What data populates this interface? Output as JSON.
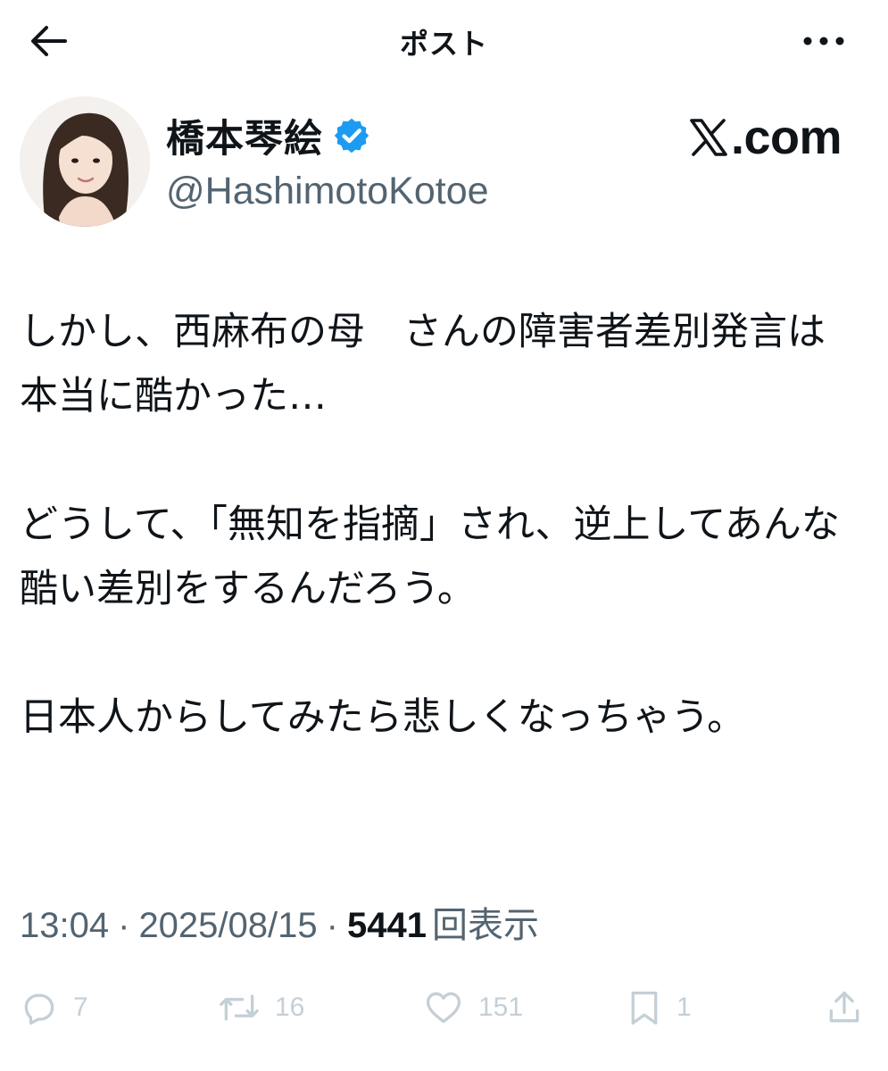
{
  "topbar": {
    "title": "ポスト",
    "back_icon": "arrow-left-icon",
    "more_icon": "ellipsis-icon"
  },
  "author": {
    "display_name": "橋本琴絵",
    "handle": "@HashimotoKotoe",
    "verified": true,
    "verified_color": "#1d9bf0"
  },
  "site": {
    "domain": ".com",
    "logo_icon": "x-logo-icon"
  },
  "post": {
    "paragraphs": [
      "しかし、西麻布の母　さんの障害者差別発言は本当に酷かった…",
      "どうして、「無知を指摘」され、逆上してあんな酷い差別をするんだろう。",
      "日本人からしてみたら悲しくなっちゃう。"
    ]
  },
  "meta": {
    "time": "13:04",
    "separator": "·",
    "date": "2025/08/15",
    "views": "5441",
    "views_label": "回表示"
  },
  "actions": {
    "reply": {
      "icon": "reply-icon",
      "count": "7"
    },
    "repost": {
      "icon": "repost-icon",
      "count": "16"
    },
    "like": {
      "icon": "heart-icon",
      "count": "151"
    },
    "bookmark": {
      "icon": "bookmark-icon",
      "count": "1"
    },
    "share": {
      "icon": "share-icon"
    }
  },
  "colors": {
    "text_primary": "#0f1419",
    "text_secondary": "#536471",
    "action_muted": "#c4cfd6",
    "accent": "#1d9bf0"
  }
}
